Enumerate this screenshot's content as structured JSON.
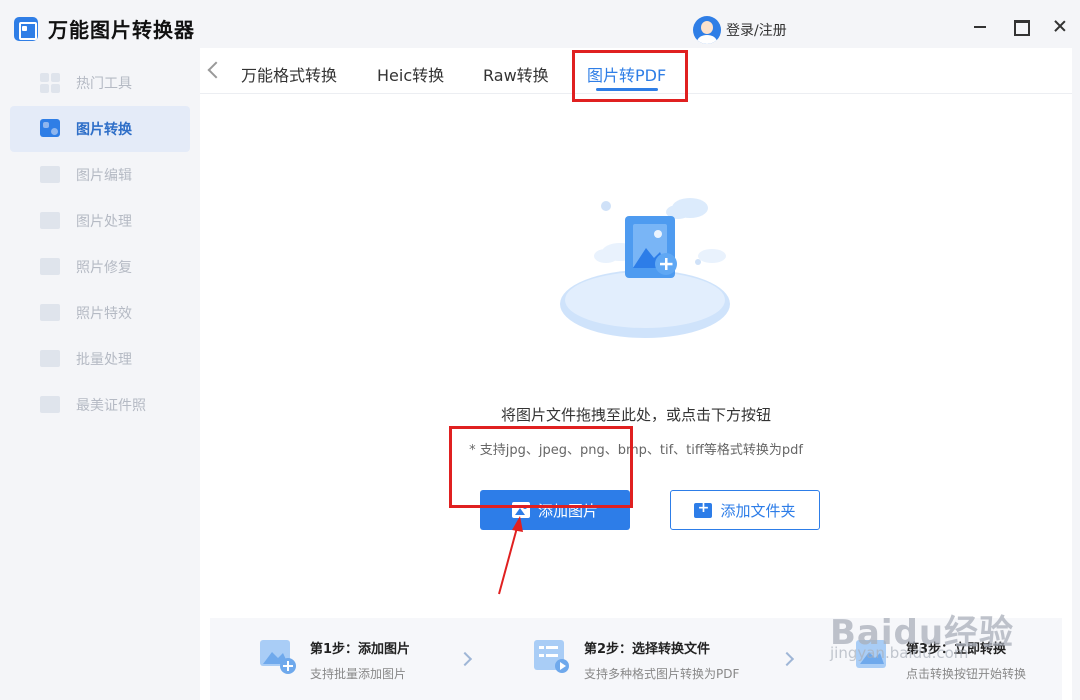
{
  "app": {
    "title": "万能图片转换器",
    "icon": "app-logo-icon",
    "accent": "#2f7ee6"
  },
  "user": {
    "login_label": "登录/注册",
    "icon": "user-avatar-icon"
  },
  "window_controls": {
    "icons": [
      "minimize-icon",
      "maximize-icon",
      "close-icon"
    ]
  },
  "sidebar": {
    "items": [
      {
        "label": "热门工具",
        "icon": "grid-tools-icon",
        "active": false
      },
      {
        "label": "图片转换",
        "icon": "image-convert-icon",
        "active": true
      },
      {
        "label": "图片编辑",
        "icon": "image-edit-icon",
        "active": false
      },
      {
        "label": "图片处理",
        "icon": "image-process-icon",
        "active": false
      },
      {
        "label": "照片修复",
        "icon": "photo-repair-icon",
        "active": false
      },
      {
        "label": "照片特效",
        "icon": "photo-effects-icon",
        "active": false
      },
      {
        "label": "批量处理",
        "icon": "batch-process-icon",
        "active": false
      },
      {
        "label": "最美证件照",
        "icon": "id-photo-icon",
        "active": false
      }
    ]
  },
  "tabs": {
    "items": [
      {
        "label": "万能格式转换",
        "active": false
      },
      {
        "label": "Heic转换",
        "active": false
      },
      {
        "label": "Raw转换",
        "active": false
      },
      {
        "label": "图片转PDF",
        "active": true
      }
    ]
  },
  "dropzone": {
    "hint": "将图片文件拖拽至此处，或点击下方按钮",
    "formats": "* 支持jpg、jpeg、png、bmp、tif、tiff等格式转换为pdf",
    "add_image_label": "添加图片",
    "add_folder_label": "添加文件夹"
  },
  "steps": [
    {
      "title": "第1步：添加图片",
      "desc": "支持批量添加图片"
    },
    {
      "title": "第2步：选择转换文件",
      "desc": "支持多种格式图片转换为PDF"
    },
    {
      "title": "第3步：立即转换",
      "desc": "点击转换按钮开始转换"
    }
  ],
  "watermark": {
    "text": "Baidu经验",
    "sub": "jingyan.baidu.com"
  },
  "annotation_color": "#e02020"
}
